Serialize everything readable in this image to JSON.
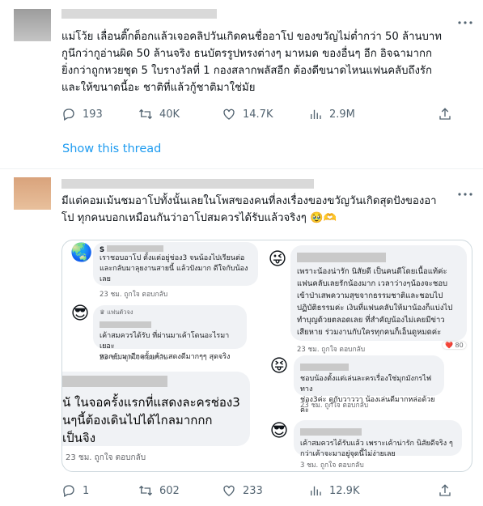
{
  "tweet1": {
    "text": "แม่โว้ย เลื่อนติ๊กต็อกแล้วเจอคลิปวันเกิดคนชื่ออาโป ของขวัญไม่ต่ำกว่า 50 ล้านบาท\nกูนึกว่ากูอ่านผิด 50 ล้านจริง ธนบัตรรูปทรงต่างๆ มาหมด ของอื่นๆ อีก  อิจฉามากก\nยิ่งกว่าถูกหวยชุด 5 ใบรางวัลที่ 1 กองสลากพลัสอีก ต้องดีขนาดไหนแฟนคลับถึงรัก\nและให้ขนาดนี้อะ ชาติที่แล้วกู้ชาติมาใช่มัย",
    "replies": "193",
    "retweets": "40K",
    "likes": "14.7K",
    "views": "2.9M",
    "show_thread": "Show this thread"
  },
  "tweet2": {
    "text": "มีแต่คอมเม้นชมอาโปทั้งนั้นเลยในโพสของคนที่ลงเรื่องของขวัญวันเกิดสุดปังของอา\nโป ทุกคนบอกเหมือนกันว่าอาโปสมควรได้รับแล้วจริงๆ 🥹🫶",
    "replies": "1",
    "retweets": "602",
    "likes": "233",
    "views": "12.9K"
  },
  "comments": {
    "c1_name": "S",
    "c1_text": "เราชอบอาโป ตั้งแต่อยู่ช่อง3 จนน้องไปเรียนต่อ\nและกลับมาลุยงานสายนี้ แล้วปังมาก ดีใจกับน้อง\nเลย",
    "c1_meta": "23 ชม.    ถูกใจ    ตอบกลับ",
    "c2_tag": "♛ แฟนตัวจง",
    "c2_text": "เค้าสมควรได้รับ ที่ผ่านมาเค้าโดนอะไรมาเยอะ\nพอกลับมาอีกครั้งเค้าแสดงดีมากๆๆ สุดจริง",
    "c2_meta": "23 ชม.    ถูกใจ    ตอบกลับ",
    "c3_text": "นั ในจอครั้งแรกที่แสดงละครช่อง3\nนๆนี้ต้องเดินไปได้ไกลมากกก\nเป็นจิง",
    "c3_meta": "23 ชม.    ถูกใจ    ตอบกลับ",
    "c4_text": "เพราะน้องน่ารัก นิสัยดี เป็นคนดีโดยเนื้อแท้ค่ะ\nแฟนคลับเลยรักน้องมาก เวลาว่างๆน้องจะชอบ\nเข้าป่าเสพความสุขจากธรรมชาติและชอบไป\nปฏิบัติธรรมค่ะ เงินที่แฟนคลับให้มาน้องก็แบ่งไป\nทำบุญด้วยตลอดเลย ที่สำคัญน้องไม่เคยมีข่าว\nเสียหาย ร่วมงานกับใครทุกคนก็เอ็นดูหมดค่ะ",
    "c4_meta": "23 ชม.   ถูกใจ   ตอบกลับ",
    "c4_count": "80",
    "c5_text": "ชอบน้องตั้งแต่เล่นละครเรื่องใช่มุกมังกรไฟ ทาง\nช่อง3ค่ะ ดูกับวาววา น้องเล่นดีมากหล่อด้วยค่ะ",
    "c5_meta": "23 ชม.   ถูกใจ   ตอบกลับ",
    "c6_text": "เค้าสมควรได้รับแล้ว เพราะเค้าน่ารัก นิสัยดีจริง ๆ\nกว่าเค้าจะมาอยู่จุดนี้ไม่ง่ายเลย",
    "c6_meta": "3 ชม.   ถูกใจ   ตอบกลับ",
    "big_meta": "23 ชม.    ถูกใจ    ตอบกลับ",
    "c3_meta_small": "23 ชม.    ถูกใจ    ตอบกลับ"
  }
}
